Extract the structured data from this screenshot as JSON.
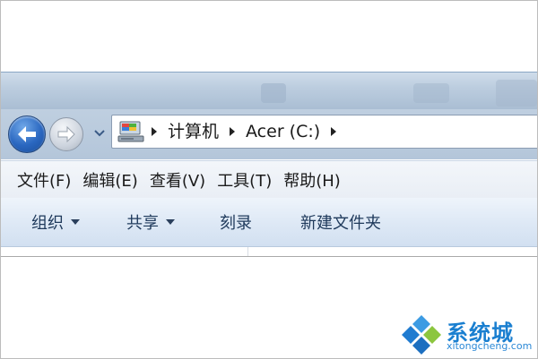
{
  "address": {
    "crumbs": [
      "计算机",
      "Acer (C:)"
    ]
  },
  "menu": {
    "items": [
      "文件(F)",
      "编辑(E)",
      "查看(V)",
      "工具(T)",
      "帮助(H)"
    ]
  },
  "commands": {
    "organize": "组织",
    "share": "共享",
    "burn": "刻录",
    "new_folder": "新建文件夹"
  },
  "watermark": {
    "brand": "系统城",
    "url": "xitongcheng.com"
  },
  "colors": {
    "back_button": "#2a67c0",
    "command_text": "#1e395b",
    "watermark": "#1a7fd0"
  }
}
